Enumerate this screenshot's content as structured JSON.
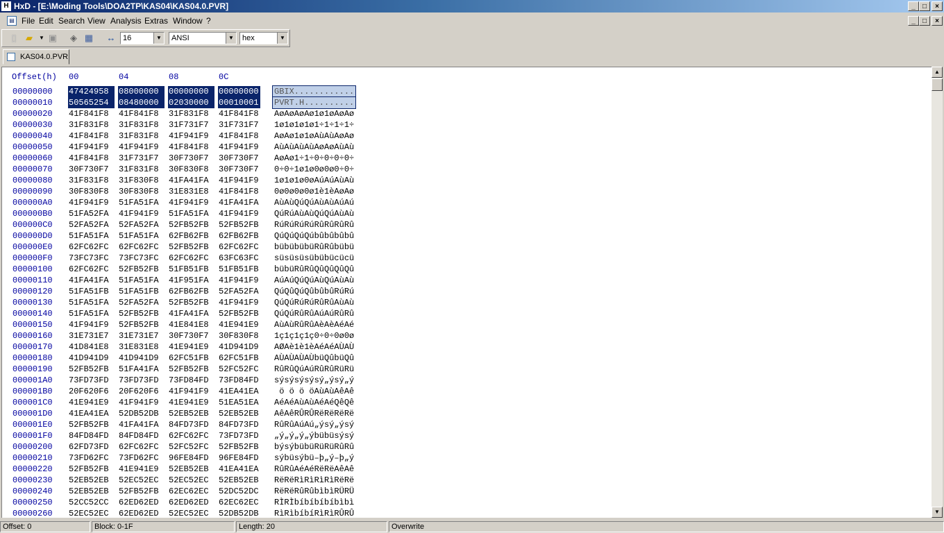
{
  "window": {
    "title": "HxD - [E:\\Moding Tools\\DOA2TP\\KAS04\\KAS04.0.PVR]",
    "controls": [
      "_",
      "□",
      "×"
    ]
  },
  "menu": [
    "File",
    "Edit",
    "Search",
    "View",
    "Analysis",
    "Extras",
    "Window",
    "?"
  ],
  "toolbar": {
    "bytes_per_row": "16",
    "charset": "ANSI",
    "offset_base": "hex"
  },
  "tab": {
    "label": "KAS04.0.PVR"
  },
  "editor": {
    "offset_header": "Offset(h)",
    "column_headers": [
      "00",
      "04",
      "08",
      "0C"
    ],
    "rows": [
      {
        "offset": "00000000",
        "hex": [
          "47424958",
          "08000000",
          "00000000",
          "00000000"
        ],
        "ascii": "GBIX............",
        "selected": true
      },
      {
        "offset": "00000010",
        "hex": [
          "50565254",
          "08480000",
          "02030000",
          "00010001"
        ],
        "ascii": "PVRT.H..........",
        "selected": true
      },
      {
        "offset": "00000020",
        "hex": [
          "41F841F8",
          "41F841F8",
          "31F831F8",
          "41F841F8"
        ],
        "ascii": "AøAøAøAø1ø1øAøAø"
      },
      {
        "offset": "00000030",
        "hex": [
          "31F831F8",
          "31F831F8",
          "31F731F7",
          "31F731F7"
        ],
        "ascii": "1ø1ø1ø1ø1÷1÷1÷1÷"
      },
      {
        "offset": "00000040",
        "hex": [
          "41F841F8",
          "31F831F8",
          "41F941F9",
          "41F841F8"
        ],
        "ascii": "AøAø1ø1øAùAùAøAø"
      },
      {
        "offset": "00000050",
        "hex": [
          "41F941F9",
          "41F941F9",
          "41F841F8",
          "41F941F9"
        ],
        "ascii": "AùAùAùAùAøAøAùAù"
      },
      {
        "offset": "00000060",
        "hex": [
          "41F841F8",
          "31F731F7",
          "30F730F7",
          "30F730F7"
        ],
        "ascii": "AøAø1÷1÷0÷0÷0÷0÷"
      },
      {
        "offset": "00000070",
        "hex": [
          "30F730F7",
          "31F831F8",
          "30F830F8",
          "30F730F7"
        ],
        "ascii": "0÷0÷1ø1ø0ø0ø0÷0÷"
      },
      {
        "offset": "00000080",
        "hex": [
          "31F831F8",
          "31F830F8",
          "41FA41FA",
          "41F941F9"
        ],
        "ascii": "1ø1ø1ø0øAúAúAùAù"
      },
      {
        "offset": "00000090",
        "hex": [
          "30F830F8",
          "30F830F8",
          "31E831E8",
          "41F841F8"
        ],
        "ascii": "0ø0ø0ø0ø1è1èAøAø"
      },
      {
        "offset": "000000A0",
        "hex": [
          "41F941F9",
          "51FA51FA",
          "41F941F9",
          "41FA41FA"
        ],
        "ascii": "AùAùQúQúAùAùAúAú"
      },
      {
        "offset": "000000B0",
        "hex": [
          "51FA52FA",
          "41F941F9",
          "51FA51FA",
          "41F941F9"
        ],
        "ascii": "QúRúAùAùQúQúAùAù"
      },
      {
        "offset": "000000C0",
        "hex": [
          "52FA52FA",
          "52FA52FA",
          "52FB52FB",
          "52FB52FB"
        ],
        "ascii": "RúRúRúRúRûRûRûRû"
      },
      {
        "offset": "000000D0",
        "hex": [
          "51FA51FA",
          "51FA51FA",
          "62FB62FB",
          "62FB62FB"
        ],
        "ascii": "QúQúQúQúbûbûbûbû"
      },
      {
        "offset": "000000E0",
        "hex": [
          "62FC62FC",
          "62FC62FC",
          "52FB52FB",
          "62FC62FC"
        ],
        "ascii": "bübübübüRûRûbübü"
      },
      {
        "offset": "000000F0",
        "hex": [
          "73FC73FC",
          "73FC73FC",
          "62FC62FC",
          "63FC63FC"
        ],
        "ascii": "süsüsüsübübücücü"
      },
      {
        "offset": "00000100",
        "hex": [
          "62FC62FC",
          "52FB52FB",
          "51FB51FB",
          "51FB51FB"
        ],
        "ascii": "bübüRûRûQûQûQûQû"
      },
      {
        "offset": "00000110",
        "hex": [
          "41FA41FA",
          "51FA51FA",
          "41F951FA",
          "41F941F9"
        ],
        "ascii": "AúAúQúQúAùQúAùAù"
      },
      {
        "offset": "00000120",
        "hex": [
          "51FA51FB",
          "51FA51FB",
          "62FB62FB",
          "52FA52FA"
        ],
        "ascii": "QúQûQúQûbûbûRúRú"
      },
      {
        "offset": "00000130",
        "hex": [
          "51FA51FA",
          "52FA52FA",
          "52FB52FB",
          "41F941F9"
        ],
        "ascii": "QúQúRúRúRûRûAùAù"
      },
      {
        "offset": "00000140",
        "hex": [
          "51FA51FA",
          "52FB52FB",
          "41FA41FA",
          "52FB52FB"
        ],
        "ascii": "QúQúRûRûAúAúRûRû"
      },
      {
        "offset": "00000150",
        "hex": [
          "41F941F9",
          "52FB52FB",
          "41E841E8",
          "41E941E9"
        ],
        "ascii": "AùAùRûRûAèAèAéAé"
      },
      {
        "offset": "00000160",
        "hex": [
          "31E731E7",
          "31E731E7",
          "30F730F7",
          "30F830F8"
        ],
        "ascii": "1ç1ç1ç1ç0÷0÷0ø0ø"
      },
      {
        "offset": "00000170",
        "hex": [
          "41D841E8",
          "31E831E8",
          "41E941E9",
          "41D941D9"
        ],
        "ascii": "AØAè1è1èAéAéAÙAÙ"
      },
      {
        "offset": "00000180",
        "hex": [
          "41D941D9",
          "41D941D9",
          "62FC51FB",
          "62FC51FB"
        ],
        "ascii": "AÙAÙAÙAÙbüQûbüQû"
      },
      {
        "offset": "00000190",
        "hex": [
          "52FB52FB",
          "51FA41FA",
          "52FB52FB",
          "52FC52FC"
        ],
        "ascii": "RûRûQúAúRûRûRüRü"
      },
      {
        "offset": "000001A0",
        "hex": [
          "73FD73FD",
          "73FD73FD",
          "73FD84FD",
          "73FD84FD"
        ],
        "ascii": "sýsýsýsýsý„ýsý„ý"
      },
      {
        "offset": "000001B0",
        "hex": [
          "20F620F6",
          "20F620F6",
          "41F941F9",
          "41EA41EA"
        ],
        "ascii": " ö ö ö öAùAùAêAê"
      },
      {
        "offset": "000001C0",
        "hex": [
          "41E941E9",
          "41F941F9",
          "41E941E9",
          "51EA51EA"
        ],
        "ascii": "AéAéAùAùAéAéQêQê"
      },
      {
        "offset": "000001D0",
        "hex": [
          "41EA41EA",
          "52DB52DB",
          "52EB52EB",
          "52EB52EB"
        ],
        "ascii": "AêAêRÛRÛRëRëRëRë"
      },
      {
        "offset": "000001E0",
        "hex": [
          "52FB52FB",
          "41FA41FA",
          "84FD73FD",
          "84FD73FD"
        ],
        "ascii": "RûRûAúAú„ýsý„ýsý"
      },
      {
        "offset": "000001F0",
        "hex": [
          "84FD84FD",
          "84FD84FD",
          "62FC62FC",
          "73FD73FD"
        ],
        "ascii": "„ý„ý„ý„ýbübüsýsý"
      },
      {
        "offset": "00000200",
        "hex": [
          "62FD73FD",
          "62FC62FC",
          "52FC52FC",
          "52FB52FB"
        ],
        "ascii": "býsýbübüRüRüRûRû"
      },
      {
        "offset": "00000210",
        "hex": [
          "73FD62FC",
          "73FD62FC",
          "96FE84FD",
          "96FE84FD"
        ],
        "ascii": "sýbüsýbü–þ„ý–þ„ý"
      },
      {
        "offset": "00000220",
        "hex": [
          "52FB52FB",
          "41E941E9",
          "52EB52EB",
          "41EA41EA"
        ],
        "ascii": "RûRûAéAéRëRëAêAê"
      },
      {
        "offset": "00000230",
        "hex": [
          "52EB52EB",
          "52EC52EC",
          "52EC52EC",
          "52EB52EB"
        ],
        "ascii": "RëRëRìRìRìRìRëRë"
      },
      {
        "offset": "00000240",
        "hex": [
          "52EB52EB",
          "52FB52FB",
          "62EC62EC",
          "52DC52DC"
        ],
        "ascii": "RëRëRûRûbìbìRÜRÜ"
      },
      {
        "offset": "00000250",
        "hex": [
          "52CC52CC",
          "62ED62ED",
          "62ED62ED",
          "62EC62EC"
        ],
        "ascii": "RÌRÌbíbíbíbíbìbì"
      },
      {
        "offset": "00000260",
        "hex": [
          "52EC52EC",
          "62ED62ED",
          "52EC52EC",
          "52DB52DB"
        ],
        "ascii": "RìRìbíbíRìRìRÛRÛ"
      }
    ]
  },
  "status": {
    "offset": "Offset: 0",
    "block": "Block: 0-1F",
    "length": "Length: 20",
    "mode": "Overwrite"
  }
}
